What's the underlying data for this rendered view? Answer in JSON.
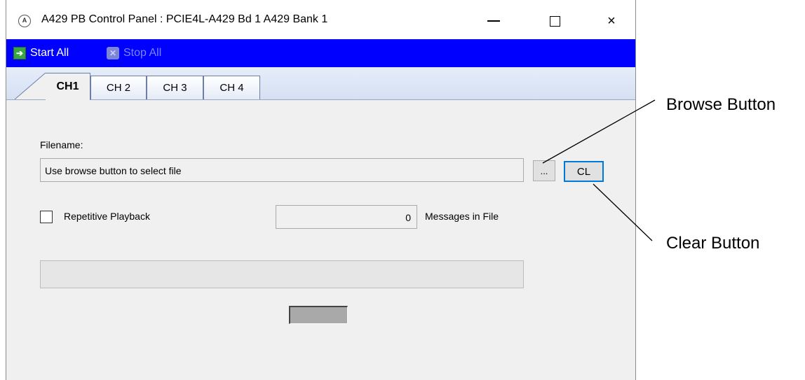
{
  "window": {
    "title": "A429 PB Control Panel : PCIE4L-A429 Bd 1 A429 Bank 1",
    "icon_text": "A",
    "controls": {
      "minimize": "minimize-icon",
      "maximize": "maximize-icon",
      "close": "×"
    }
  },
  "toolbar": {
    "start_all": "Start All",
    "stop_all": "Stop All",
    "start_icon": "arrow-right-icon",
    "stop_icon": "x-icon"
  },
  "tabs": [
    {
      "label": "CH1",
      "active": true
    },
    {
      "label": "CH 2",
      "active": false
    },
    {
      "label": "CH 3",
      "active": false
    },
    {
      "label": "CH 4",
      "active": false
    }
  ],
  "form": {
    "filename_label": "Filename:",
    "filename_value": "Use browse button to select file",
    "browse_button": "...",
    "clear_button": "CL",
    "repetitive_label": "Repetitive Playback",
    "repetitive_checked": false,
    "message_count": "0",
    "messages_label": "Messages in File"
  },
  "annotations": {
    "browse": "Browse Button",
    "clear": "Clear Button"
  },
  "colors": {
    "toolbar_bg": "#0000ff",
    "clear_border": "#0078d7",
    "start_icon_bg": "#3aa640"
  }
}
